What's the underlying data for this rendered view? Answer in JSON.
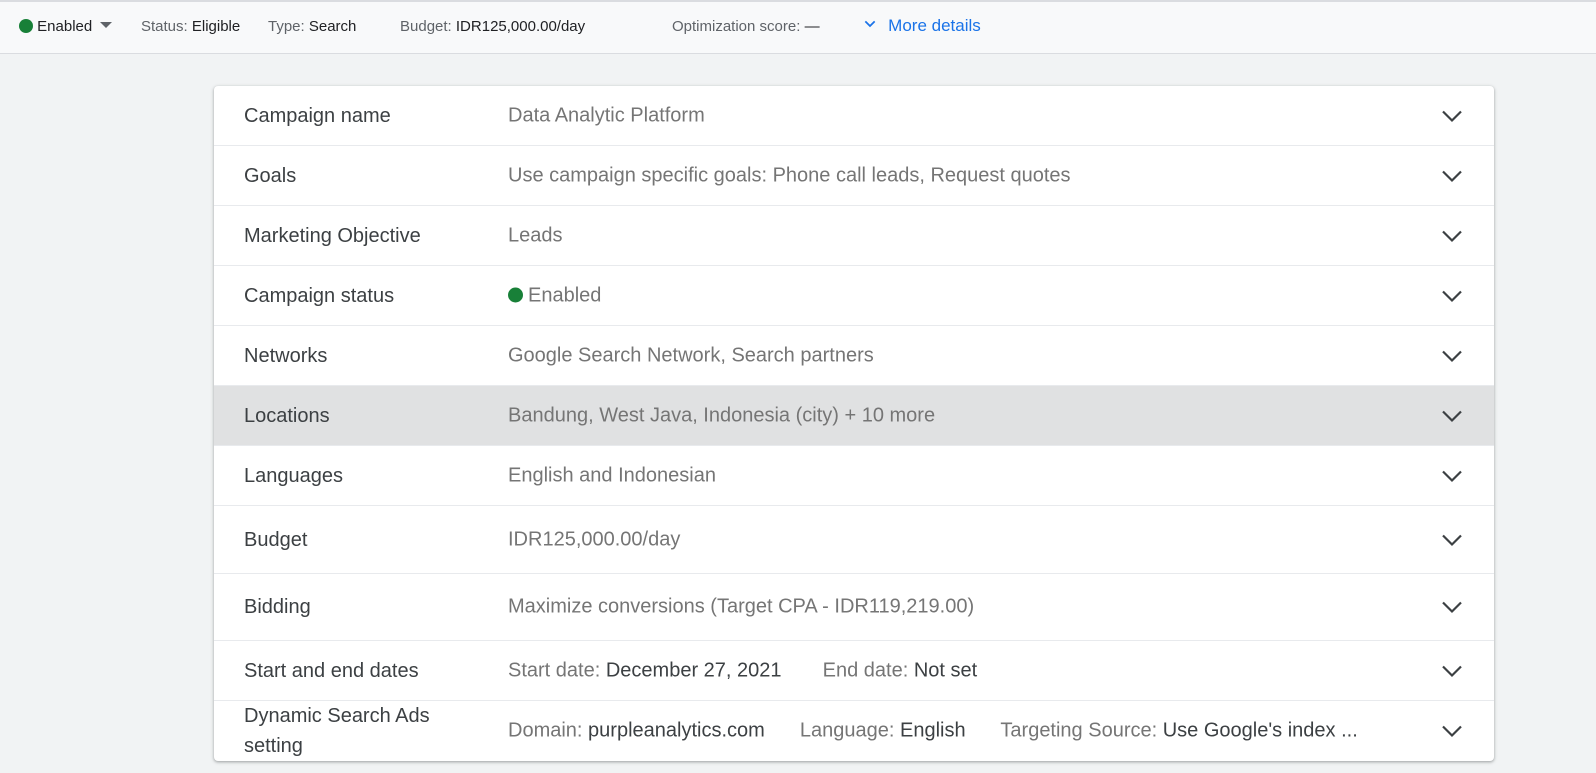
{
  "topbar": {
    "status_toggle": "Enabled",
    "status_label": "Status:",
    "status_value": "Eligible",
    "type_label": "Type:",
    "type_value": "Search",
    "budget_label": "Budget:",
    "budget_value": "IDR125,000.00/day",
    "opt_label": "Optimization score:",
    "opt_value": "—",
    "more_details": "More details"
  },
  "rows": {
    "campaign_name": {
      "label": "Campaign name",
      "value": "Data Analytic Platform"
    },
    "goals": {
      "label": "Goals",
      "value": "Use campaign specific goals: Phone call leads, Request quotes"
    },
    "objective": {
      "label": "Marketing Objective",
      "value": "Leads"
    },
    "status": {
      "label": "Campaign status",
      "value": "Enabled"
    },
    "networks": {
      "label": "Networks",
      "value": "Google Search Network, Search partners"
    },
    "locations": {
      "label": "Locations",
      "value": "Bandung, West Java, Indonesia (city) + 10 more"
    },
    "languages": {
      "label": "Languages",
      "value": "English and Indonesian"
    },
    "budget": {
      "label": "Budget",
      "value": "IDR125,000.00/day"
    },
    "bidding": {
      "label": "Bidding",
      "value": "Maximize conversions (Target CPA - IDR119,219.00)"
    },
    "dates": {
      "label": "Start and end dates",
      "start_label": "Start date:",
      "start_value": "December 27, 2021",
      "end_label": "End date:",
      "end_value": "Not set"
    },
    "dsa": {
      "label": "Dynamic Search Ads setting",
      "domain_label": "Domain:",
      "domain_value": "purpleanalytics.com",
      "lang_label": "Language:",
      "lang_value": "English",
      "source_label": "Targeting Source:",
      "source_value": "Use Google's index ..."
    }
  },
  "colors": {
    "enabled_green": "#188038",
    "link_blue": "#1a73e8",
    "highlight_row": "#e0e1e2"
  }
}
